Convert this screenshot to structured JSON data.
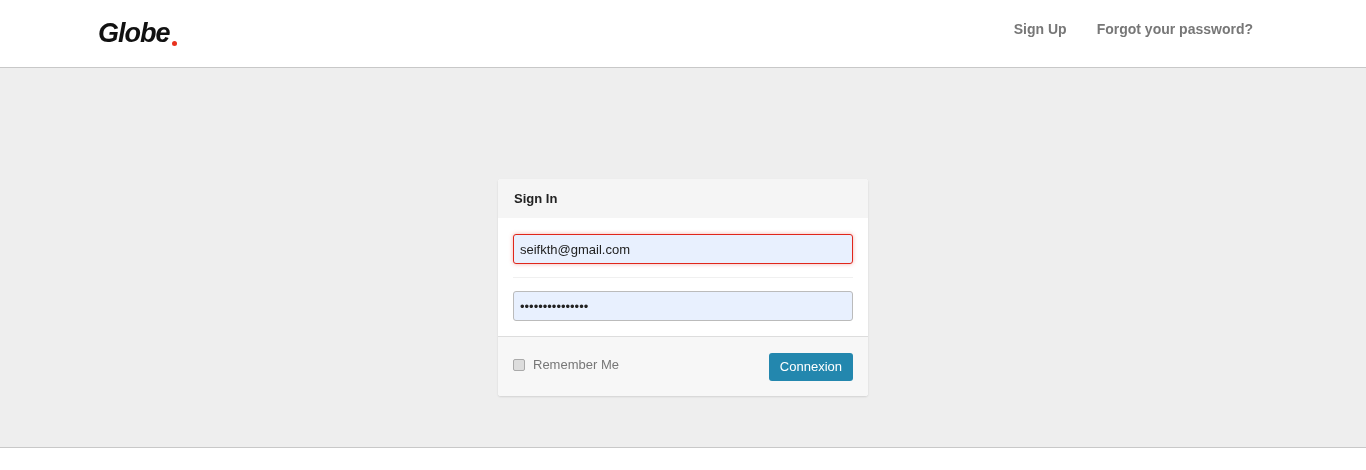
{
  "header": {
    "logo": "Globe",
    "links": [
      "Sign Up",
      "Forgot your password?"
    ]
  },
  "sign_in": {
    "title": "Sign In",
    "email": {
      "value": "seifkth@gmail.com",
      "invalid": true
    },
    "password": {
      "value": "•••••••••••••••",
      "invalid": false
    },
    "remember_me": {
      "label": "Remember Me",
      "checked": false
    },
    "button": "Connexion"
  }
}
